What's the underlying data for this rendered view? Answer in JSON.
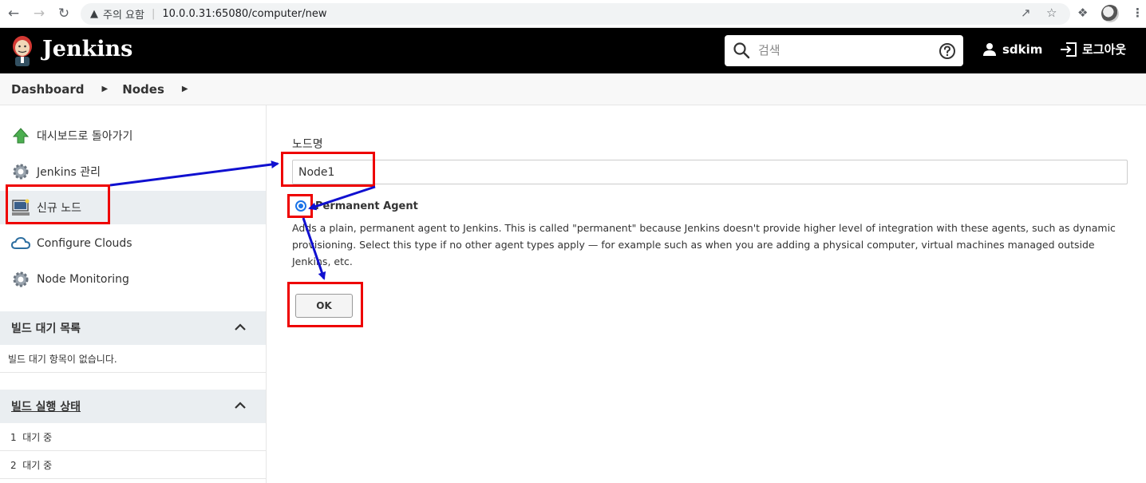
{
  "browser": {
    "security_label": "주의 요함",
    "url": "10.0.0.31:65080/computer/new"
  },
  "header": {
    "title": "Jenkins",
    "search_placeholder": "검색",
    "username": "sdkim",
    "logout_label": "로그아웃"
  },
  "breadcrumb": {
    "items": [
      "Dashboard",
      "Nodes"
    ]
  },
  "sidebar": {
    "items": [
      {
        "label": "대시보드로 돌아가기",
        "icon": "up-arrow-icon"
      },
      {
        "label": "Jenkins 관리",
        "icon": "gear-icon"
      },
      {
        "label": "신규 노드",
        "icon": "computer-icon"
      },
      {
        "label": "Configure Clouds",
        "icon": "cloud-icon"
      },
      {
        "label": "Node Monitoring",
        "icon": "gear-icon"
      }
    ],
    "queue_panel": {
      "title": "빌드 대기 목록",
      "empty_text": "빌드 대기 항목이 없습니다."
    },
    "executor_panel": {
      "title": "빌드 실행 상태",
      "rows": [
        "1  대기 중",
        "2  대기 중"
      ]
    }
  },
  "main": {
    "node_name_label": "노드명",
    "node_name_value": "Node1",
    "agent_type_label": "Permanent Agent",
    "agent_type_description": "Adds a plain, permanent agent to Jenkins. This is called \"permanent\" because Jenkins doesn't provide higher level of integration with these agents, such as dynamic provisioning. Select this type if no other agent types apply — for example such as when you are adding a physical computer, virtual machines managed outside Jenkins, etc.",
    "ok_label": "OK"
  },
  "colors": {
    "header_bg": "#000000",
    "highlight": "#e00000",
    "annotation_arrow": "#1010d0",
    "radio": "#1a73e8"
  }
}
